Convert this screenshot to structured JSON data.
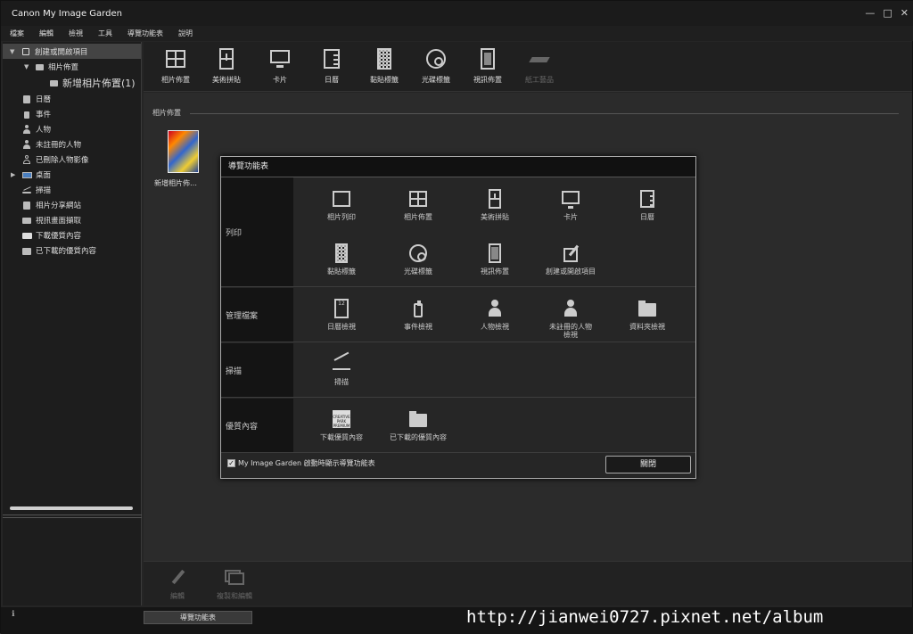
{
  "window": {
    "title": "Canon My Image Garden",
    "controls": [
      "—",
      "□",
      "✕"
    ]
  },
  "menu": [
    "檔案",
    "編輯",
    "檢視",
    "工具",
    "導覽功能表",
    "說明"
  ],
  "sidebar": {
    "items": [
      {
        "label": "創建或開啟項目",
        "icon": "create-icon",
        "expander": "▼"
      },
      {
        "label": "相片佈置",
        "icon": "layout-icon",
        "expander": "▼"
      },
      {
        "label": "新增相片佈置(1)",
        "icon": "layout-icon"
      },
      {
        "label": "日曆",
        "icon": "calendar-icon"
      },
      {
        "label": "事件",
        "icon": "event-icon"
      },
      {
        "label": "人物",
        "icon": "person-icon"
      },
      {
        "label": "未註冊的人物",
        "icon": "person-unknown-icon"
      },
      {
        "label": "已刪除人物影像",
        "icon": "person-deleted-icon"
      },
      {
        "label": "桌面",
        "icon": "desktop-icon",
        "expander": "▶"
      },
      {
        "label": "掃描",
        "icon": "scan-icon"
      },
      {
        "label": "相片分享網站",
        "icon": "share-icon"
      },
      {
        "label": "視訊畫面擷取",
        "icon": "video-icon"
      },
      {
        "label": "下載優質內容",
        "icon": "download-icon"
      },
      {
        "label": "已下載的優質內容",
        "icon": "folder-icon"
      }
    ]
  },
  "toolbar": [
    {
      "label": "相片佈置",
      "icon": "photo-layout-icon",
      "enabled": true
    },
    {
      "label": "美術拼貼",
      "icon": "collage-icon",
      "enabled": true
    },
    {
      "label": "卡片",
      "icon": "card-icon",
      "enabled": true
    },
    {
      "label": "日曆",
      "icon": "calendar-icon",
      "enabled": true
    },
    {
      "label": "黏貼標籤",
      "icon": "sticker-icon",
      "enabled": true
    },
    {
      "label": "光碟標籤",
      "icon": "disc-icon",
      "enabled": true
    },
    {
      "label": "視訊佈置",
      "icon": "video-layout-icon",
      "enabled": true
    },
    {
      "label": "紙工藝品",
      "icon": "paper-craft-icon",
      "enabled": false
    }
  ],
  "main": {
    "section_title": "相片佈置",
    "thumb_label": "新增相片佈…"
  },
  "bottom": [
    {
      "label": "編輯",
      "icon": "pencil-icon"
    },
    {
      "label": "複製和編輯",
      "icon": "copy-edit-icon"
    }
  ],
  "status": {
    "nav_tab": "導覽功能表",
    "info": "ℹ",
    "watermark": "http://jianwei0727.pixnet.net/album"
  },
  "dialog": {
    "title": "導覽功能表",
    "rows": [
      {
        "label": "列印",
        "items": [
          "相片列印",
          "相片佈置",
          "美術拼貼",
          "卡片",
          "日曆",
          "黏貼標籤",
          "光碟標籤",
          "視訊佈置",
          "創建或開啟項目"
        ]
      },
      {
        "label": "管理檔案",
        "items": [
          "日曆檢視",
          "事件檢視",
          "人物檢視",
          "未註冊的人物\n檢視",
          "資料夾檢視"
        ]
      },
      {
        "label": "掃描",
        "items": [
          "掃描"
        ]
      },
      {
        "label": "優質內容",
        "items": [
          "下載優質內容",
          "已下載的優質內容"
        ]
      }
    ],
    "cc_text": "CREATIVE PARK PREMIUM",
    "calendar_day": "12",
    "checkbox_label": "My Image Garden 啟動時顯示導覽功能表",
    "checkbox_checked": true,
    "close_label": "關閉"
  }
}
